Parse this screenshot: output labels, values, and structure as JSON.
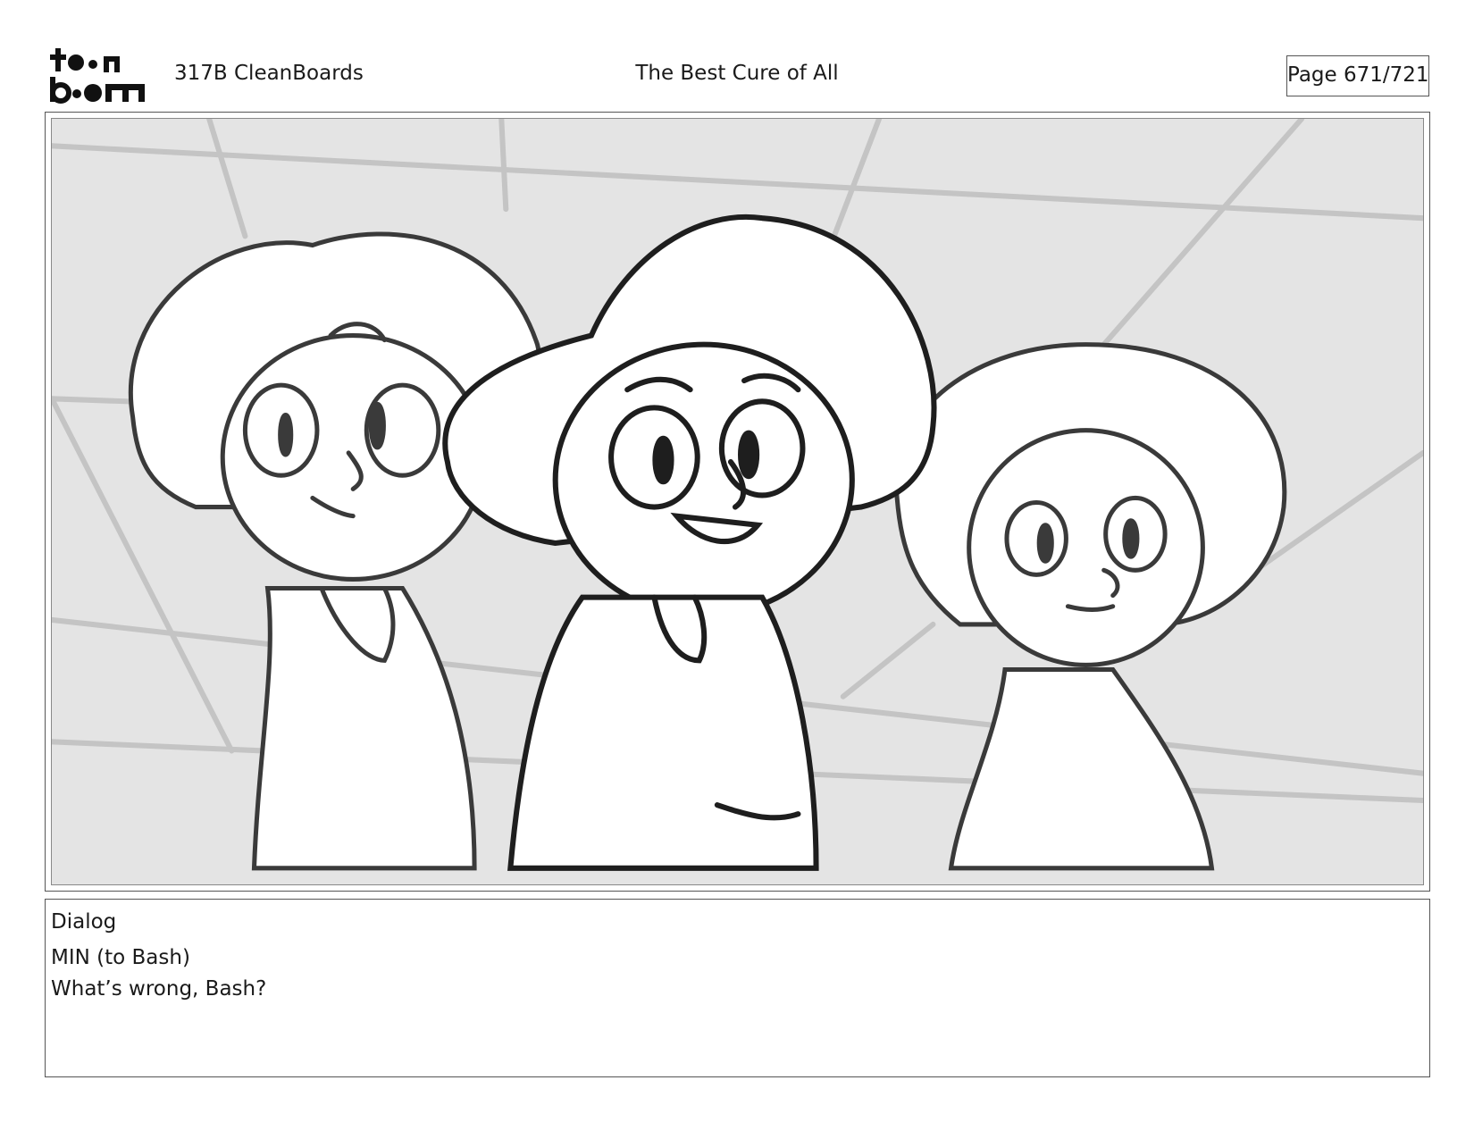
{
  "header": {
    "logo_text": "toonboom",
    "project": "317B  CleanBoards",
    "title": "The Best Cure of All",
    "page": "Page 671/721"
  },
  "panel": {
    "image": "storyboard-sketch-three-kids-in-bonnets"
  },
  "dialog": {
    "label": "Dialog",
    "lines": [
      "MIN (to Bash)",
      "What’s wrong, Bash?"
    ]
  },
  "colors": {
    "background_sketch": "#e4e4e4",
    "line_dark": "#3a3a3a",
    "line_light": "#c4c4c4",
    "border": "#555555"
  }
}
